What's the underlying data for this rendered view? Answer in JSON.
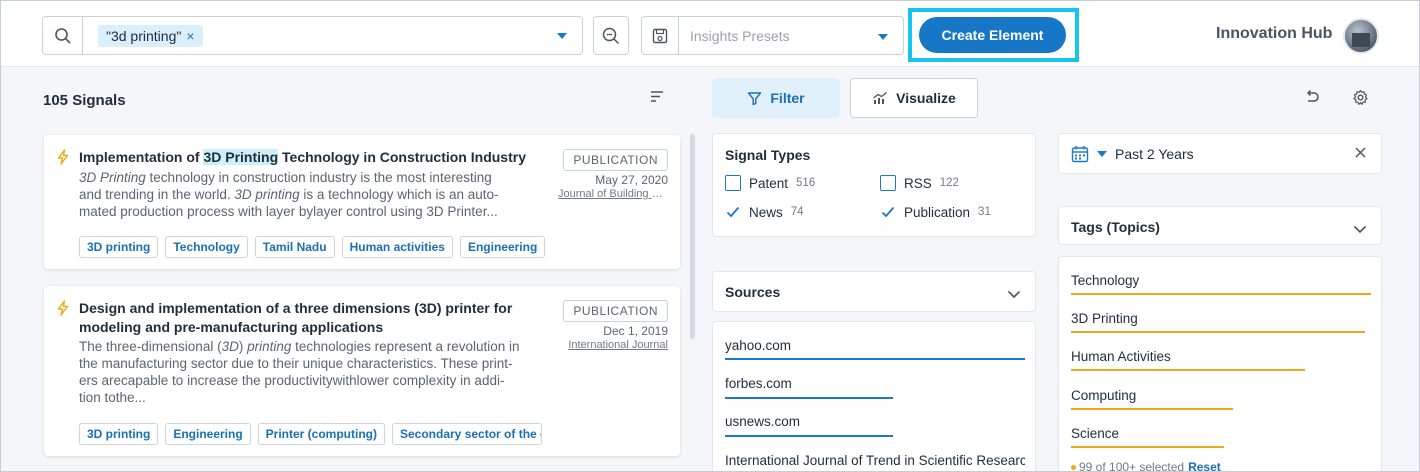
{
  "header": {
    "search_chip": "\"3d printing\"",
    "chip_remove": "×",
    "presets_placeholder": "Insights Presets",
    "create_button": "Create Element",
    "hub_name": "Innovation Hub"
  },
  "signals": {
    "count_label": "105 Signals",
    "cards": [
      {
        "title_pre": "Implementation of ",
        "title_hl": "3D Printing",
        "title_post": " Technology in Construction Industry",
        "type": "PUBLICATION",
        "date": "May 27, 2020",
        "source": "Journal of Building Engineering",
        "body_line1_em": "3D Printing",
        "body_line1": " technology in construction industry is the most interesting",
        "body_line2_pre": "and trending in the world. ",
        "body_line2_em": "3D printing",
        "body_line2_post": " is a technology which is an auto-",
        "body_line3": "mated production process with layer bylayer control using 3D Printer...",
        "tags": [
          "3D printing",
          "Technology",
          "Tamil Nadu",
          "Human activities",
          "Engineering"
        ]
      },
      {
        "title_line1": "Design and implementation of a three dimensions (3D) printer for",
        "title_line2": "modeling and pre-manufacturing applications",
        "type": "PUBLICATION",
        "date": "Dec 1, 2019",
        "source": "International Journal",
        "body_pre": "The three-dimensional (",
        "body_em1": "3D",
        "body_mid": ") ",
        "body_em2": "printing",
        "body_post": " technologies represent a revolution in",
        "body_line2": "the manufacturing sector due to their unique characteristics. These print-",
        "body_line3": "ers arecapable to increase the productivitywithlower complexity in addi-",
        "body_line4": "tion tothe...",
        "tags": [
          "3D printing",
          "Engineering",
          "Printer (computing)",
          "Secondary sector of the economy"
        ]
      }
    ]
  },
  "toolbar": {
    "filter_label": "Filter",
    "visualize_label": "Visualize"
  },
  "signal_types": {
    "title": "Signal Types",
    "items": [
      {
        "label": "Patent",
        "count": "516",
        "checked": false
      },
      {
        "label": "RSS",
        "count": "122",
        "checked": false
      },
      {
        "label": "News",
        "count": "74",
        "checked": true
      },
      {
        "label": "Publication",
        "count": "31",
        "checked": true
      }
    ]
  },
  "sources": {
    "title": "Sources",
    "items": [
      {
        "label": "yahoo.com",
        "share": 1.0
      },
      {
        "label": "forbes.com",
        "share": 0.56
      },
      {
        "label": "usnews.com",
        "share": 0.56
      },
      {
        "label": "International Journal of Trend in Scientific Research",
        "share": 0.3
      }
    ]
  },
  "date_filter": {
    "label": "Past 2 Years"
  },
  "tags_topics": {
    "title": "Tags (Topics)",
    "items": [
      {
        "label": "Technology",
        "share": 1.0
      },
      {
        "label": "3D Printing",
        "share": 0.98
      },
      {
        "label": "Human Activities",
        "share": 0.78
      },
      {
        "label": "Computing",
        "share": 0.54
      },
      {
        "label": "Science",
        "share": 0.51
      }
    ],
    "footer_text": "99 of 100+ selected",
    "reset_label": "Reset"
  },
  "colors": {
    "accent": "#1677c6",
    "highlight_border": "#17c4f0",
    "source_bar": "#1a79c9",
    "tag_bar": "#f0a818"
  }
}
